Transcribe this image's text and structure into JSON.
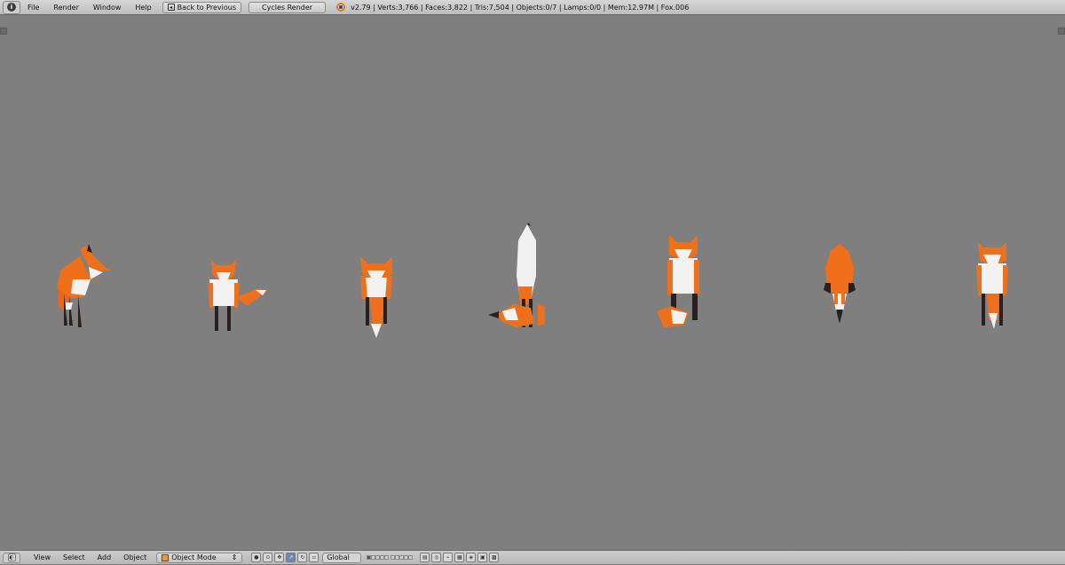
{
  "top_header": {
    "menus": [
      "File",
      "Render",
      "Window",
      "Help"
    ],
    "back_button": "Back to Previous",
    "render_engine": "Cycles Render",
    "stats": "v2.79 | Verts:3,766 | Faces:3,822 | Tris:7,504 | Objects:0/7 | Lamps:0/0 | Mem:12.97M | Fox.006"
  },
  "viewport": {
    "background": "#7f7f7f",
    "objects": [
      "fox-side",
      "fox-front-tail-right",
      "fox-front-low",
      "fox-back-tail-left",
      "fox-front-sitting",
      "fox-top",
      "fox-front"
    ]
  },
  "bottom_header": {
    "menus": [
      "View",
      "Select",
      "Add",
      "Object"
    ],
    "mode": "Object Mode",
    "orientation": "Global"
  },
  "colors": {
    "fox_orange": "#ef6f1a",
    "fox_white": "#f2f2f2",
    "fox_dark": "#2a2020",
    "ui_header": "#c9c9c9"
  }
}
